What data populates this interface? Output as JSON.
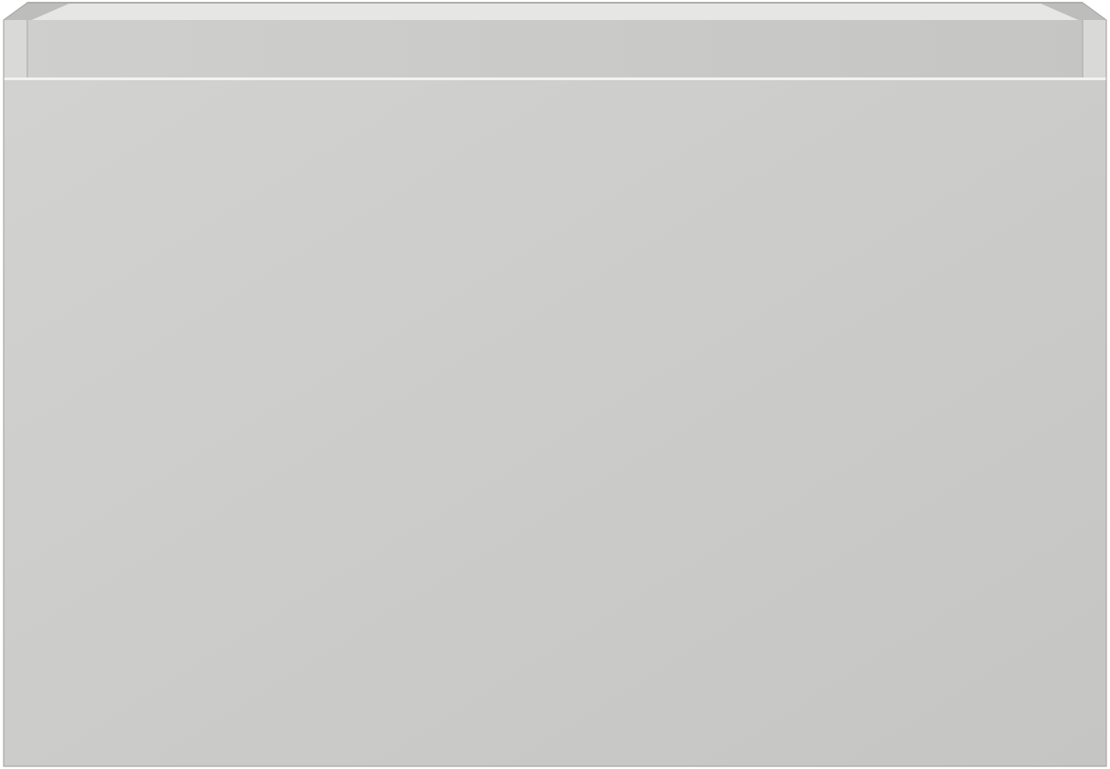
{
  "object": {
    "kind": "wall-hung vanity cabinet with single drawer",
    "handle": "none",
    "colors": {
      "background": "#ffffff",
      "front_light": "#d2d2d0",
      "front_dark": "#c5c5c3",
      "top_rim": "#cfcfcd",
      "top_inner": "#e6e6e4",
      "top_back_edge": "#b9b9b7",
      "side_rail": "#d9d9d7",
      "side_rail_shade": "#bdbdbb",
      "gap_line": "#f2f2f0",
      "outline": "#a9a9a7"
    }
  }
}
